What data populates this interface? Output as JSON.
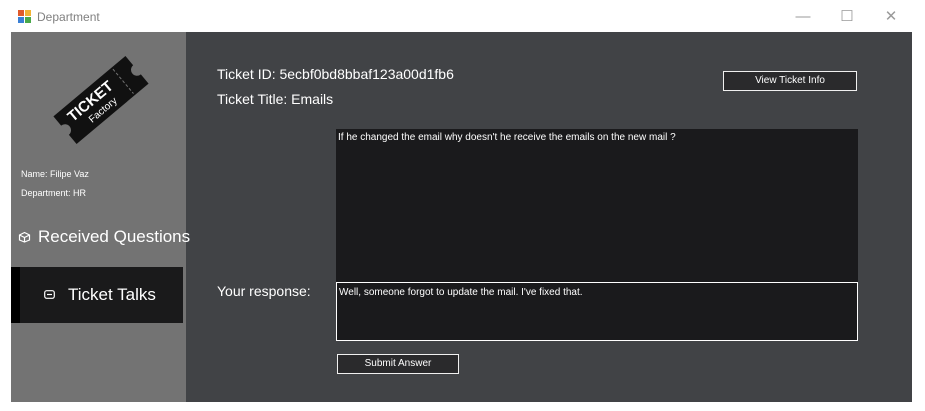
{
  "window": {
    "title": "Department",
    "minimize_glyph": "—",
    "maximize_glyph": "☐",
    "close_glyph": "✕",
    "icon": "app-window-icon"
  },
  "sidebar": {
    "logo": {
      "line1": "TICKET",
      "line2": "Factory",
      "icon": "ticket-logo"
    },
    "user_name": "Name: Filipe Vaz",
    "user_department": "Department: HR",
    "nav": [
      {
        "label": "Received Questions",
        "icon": "box-icon",
        "active": false
      },
      {
        "label": "Ticket Talks",
        "icon": "chat-icon",
        "active": true
      }
    ]
  },
  "main": {
    "ticket_id": "Ticket ID: 5ecbf0bd8bbaf123a00d1fb6",
    "ticket_title": "Ticket Title: Emails",
    "view_button": "View Ticket Info",
    "question": "If he changed the email why doesn't he receive the emails on the new mail ?",
    "response_label": "Your response:",
    "response": "Well, someone forgot to update the mail. I've fixed that.",
    "submit_button": "Submit Answer"
  },
  "colors": {
    "panel": "#414346",
    "sidebar": "#737373",
    "nav_active": "#1a1a1b",
    "textbox": "#1a1a1c"
  }
}
